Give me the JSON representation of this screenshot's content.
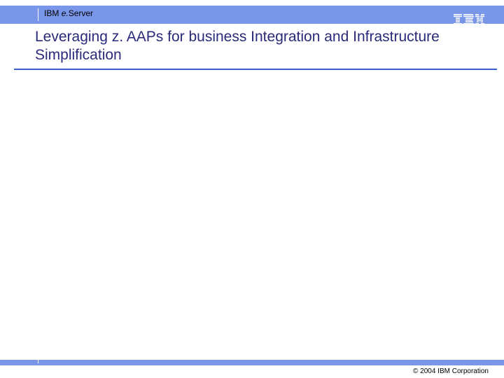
{
  "banner": {
    "brand": "IBM",
    "product_prefix": "e.",
    "product": "Server"
  },
  "title": "Leveraging z. AAPs for business Integration and Infrastructure Simplification",
  "footer": {
    "copyright": "© 2004 IBM Corporation"
  },
  "icons": {
    "logo": "ibm-logo"
  },
  "colors": {
    "banner": "#7a96e8",
    "title": "#2a2a7a",
    "rule": "#3a5fcd"
  }
}
